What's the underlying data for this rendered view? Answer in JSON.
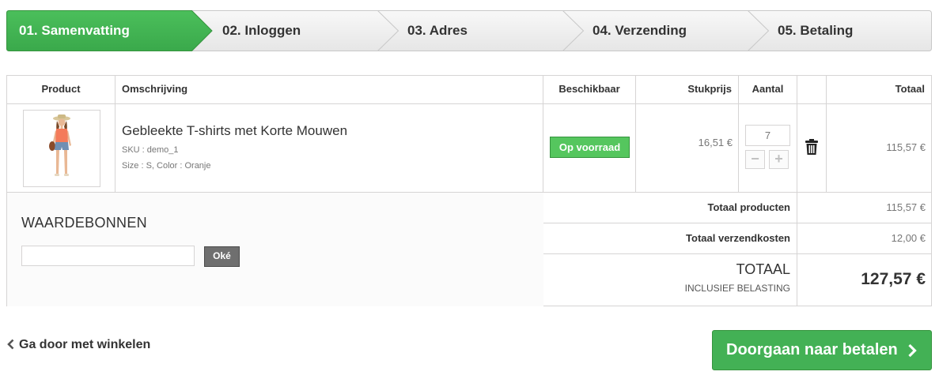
{
  "steps": [
    {
      "label": "01. Samenvatting",
      "active": true
    },
    {
      "label": "02. Inloggen",
      "active": false
    },
    {
      "label": "03. Adres",
      "active": false
    },
    {
      "label": "04. Verzending",
      "active": false
    },
    {
      "label": "05. Betaling",
      "active": false
    }
  ],
  "cart": {
    "headers": {
      "product": "Product",
      "description": "Omschrijving",
      "availability": "Beschikbaar",
      "unit_price": "Stukprijs",
      "quantity": "Aantal",
      "total": "Totaal"
    },
    "item": {
      "name": "Gebleekte T-shirts met Korte Mouwen",
      "sku": "SKU : demo_1",
      "attributes": "Size : S, Color : Oranje",
      "availability": "Op voorraad",
      "unit_price": "16,51 €",
      "quantity": "7",
      "total": "115,57 €"
    },
    "vouchers": {
      "title": "WAARDEBONNEN",
      "input_value": "",
      "button_label": "Oké"
    },
    "summary": {
      "products_label": "Totaal producten",
      "products_value": "115,57 €",
      "shipping_label": "Totaal verzendkosten",
      "shipping_value": "12,00 €",
      "grand_label": "TOTAAL",
      "grand_sub": "INCLUSIEF BELASTING",
      "grand_value": "127,57 €"
    }
  },
  "actions": {
    "continue_label": "Ga door met winkelen",
    "checkout_label": "Doorgaan naar betalen"
  },
  "colors": {
    "accent_green": "#43b155",
    "stock_green": "#55c65e",
    "border": "#d6d4d4"
  }
}
